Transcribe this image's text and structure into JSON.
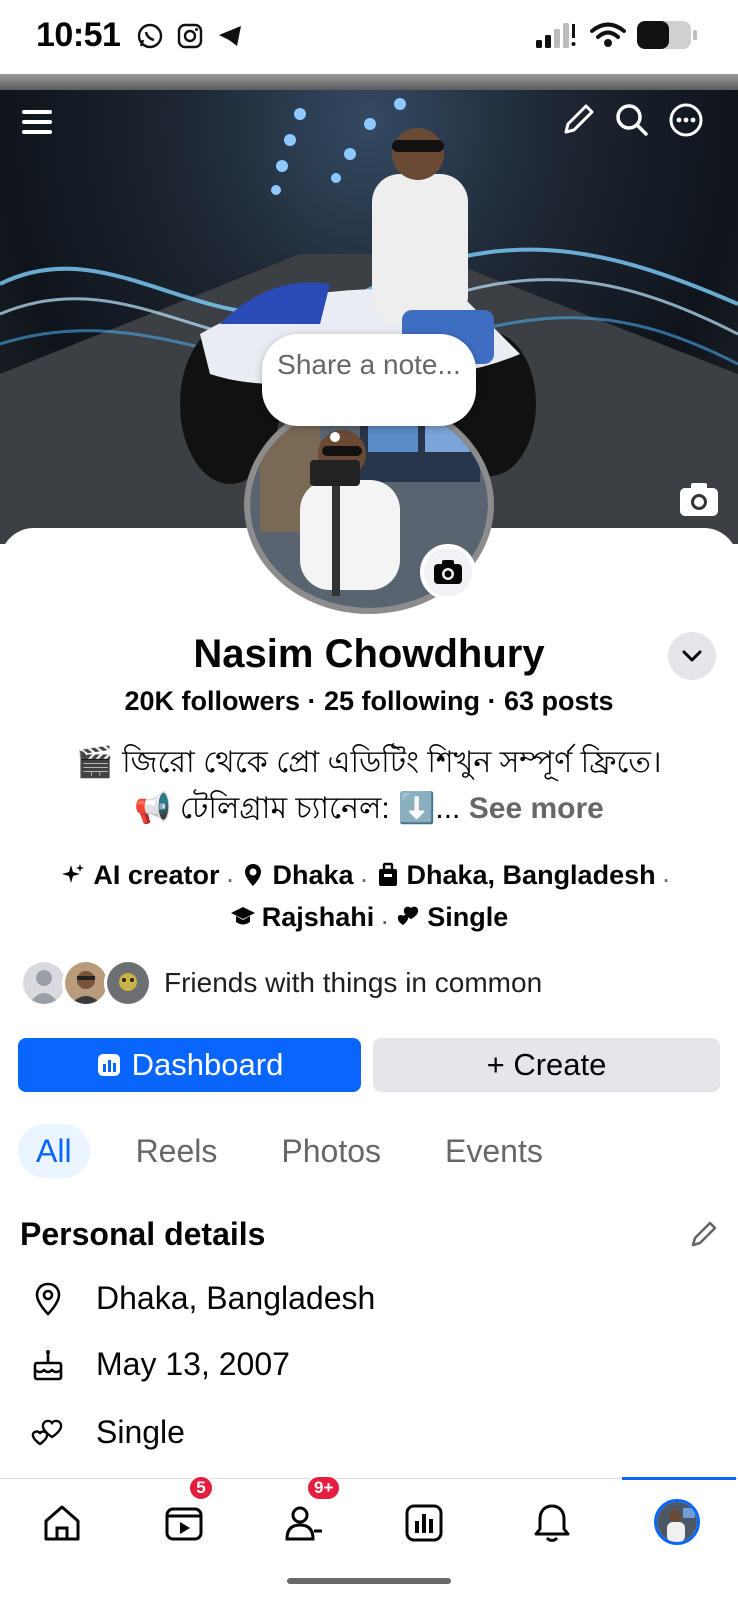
{
  "status_bar": {
    "time": "10:51",
    "apps": [
      "whatsapp-icon",
      "instagram-icon",
      "telegram-icon"
    ]
  },
  "cover": {
    "icons": [
      "menu-icon",
      "pencil-icon",
      "search-icon",
      "more-icon"
    ]
  },
  "note": {
    "placeholder": "Share a note..."
  },
  "profile": {
    "name": "Nasim Chowdhury",
    "stats": "20K followers · 25 following · 63 posts",
    "bio_line1": "🎬 জিরো থেকে প্রো এডিটিং শিখুন সম্পূর্ণ ফ্রিতে।",
    "bio_line2": "📢 টেলিগ্রাম চ্যানেল: ⬇️...",
    "see_more": "See more",
    "intro": {
      "role": "AI creator",
      "location": "Dhaka",
      "hometown": "Dhaka, Bangladesh",
      "education": "Rajshahi",
      "relationship": "Single"
    },
    "friends_text": "Friends with things in common"
  },
  "actions": {
    "dashboard_label": "Dashboard",
    "create_label": "+ Create"
  },
  "tabs": [
    {
      "label": "All",
      "active": true
    },
    {
      "label": "Reels",
      "active": false
    },
    {
      "label": "Photos",
      "active": false
    },
    {
      "label": "Events",
      "active": false
    }
  ],
  "personal_details": {
    "title": "Personal details",
    "location": "Dhaka, Bangladesh",
    "birthday": "May 13, 2007",
    "relationship": "Single"
  },
  "bottom_nav": {
    "reels_badge": "5",
    "friends_badge": "9+"
  },
  "colors": {
    "accent": "#0866ff",
    "badge": "#e41e3f",
    "secondary_text": "#65676b"
  }
}
